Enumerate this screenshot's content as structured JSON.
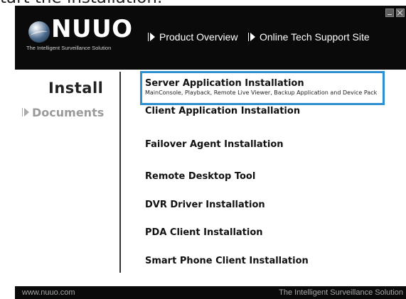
{
  "caption": "tart the installation.",
  "window": {
    "logo_text": "NUUO",
    "logo_tagline": "The Intelligent Surveillance Solution",
    "header_links": [
      {
        "label": "Product Overview"
      },
      {
        "label": "Online Tech Support Site"
      }
    ],
    "tabs": {
      "install": "Install",
      "documents": "Documents"
    },
    "items": [
      {
        "label": "Server Application Installation",
        "description": "MainConsole, Playback, Remote Live Viewer, Backup Application and Device Pack"
      },
      {
        "label": "Client Application Installation"
      },
      {
        "label": "Failover Agent Installation"
      },
      {
        "label": "Remote Desktop Tool"
      },
      {
        "label": "DVR Driver Installation"
      },
      {
        "label": "PDA Client Installation"
      },
      {
        "label": "Smart Phone Client Installation"
      }
    ],
    "footer": {
      "left": "www.nuuo.com",
      "right": "The Intelligent Surveillance Solution"
    },
    "colors": {
      "header_bg": "#0a0a0a",
      "highlight_border": "#2d8fd0"
    }
  }
}
